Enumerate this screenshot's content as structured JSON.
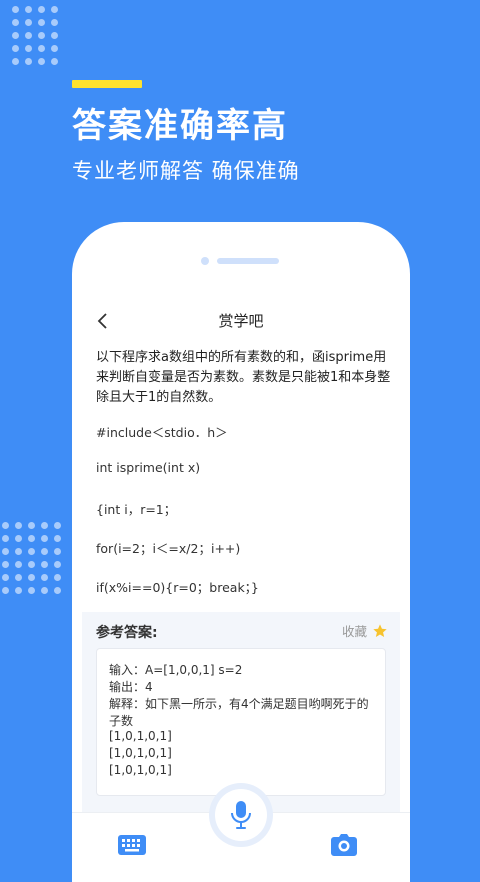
{
  "promo": {
    "headline": "答案准确率高",
    "subline": "专业老师解答 确保准确"
  },
  "app": {
    "title": "赏学吧"
  },
  "question": {
    "text": "以下程序求a数组中的所有素数的和，函isprime用来判断自变量是否为素数。素数是只能被1和本身整除且大于1的自然数。",
    "code": [
      "#include＜stdio．h＞",
      "int isprime(int x)",
      "{int i，r=1；",
      "for(i=2；i＜=x/2；i++)",
      "if(x%i==0){r=0；break；}"
    ]
  },
  "answer": {
    "label": "参考答案:",
    "collect_label": "收藏",
    "lines": [
      "输入：A=[1,0,0,1] s=2",
      "输出：4",
      "解释：如下黑一所示，有4个满足题目哟啊死于的",
      "子数",
      "[1,0,1,0,1]",
      "[1,0,1,0,1]",
      "[1,0,1,0,1]"
    ]
  },
  "icons": {
    "back": "chevron-left-icon",
    "star": "star-icon",
    "keyboard": "keyboard-icon",
    "mic": "microphone-icon",
    "camera": "camera-icon"
  },
  "colors": {
    "background": "#3f8df6",
    "accent_bar": "#ffe22e",
    "star": "#f7c32e",
    "primary_blue": "#3f8df6"
  }
}
